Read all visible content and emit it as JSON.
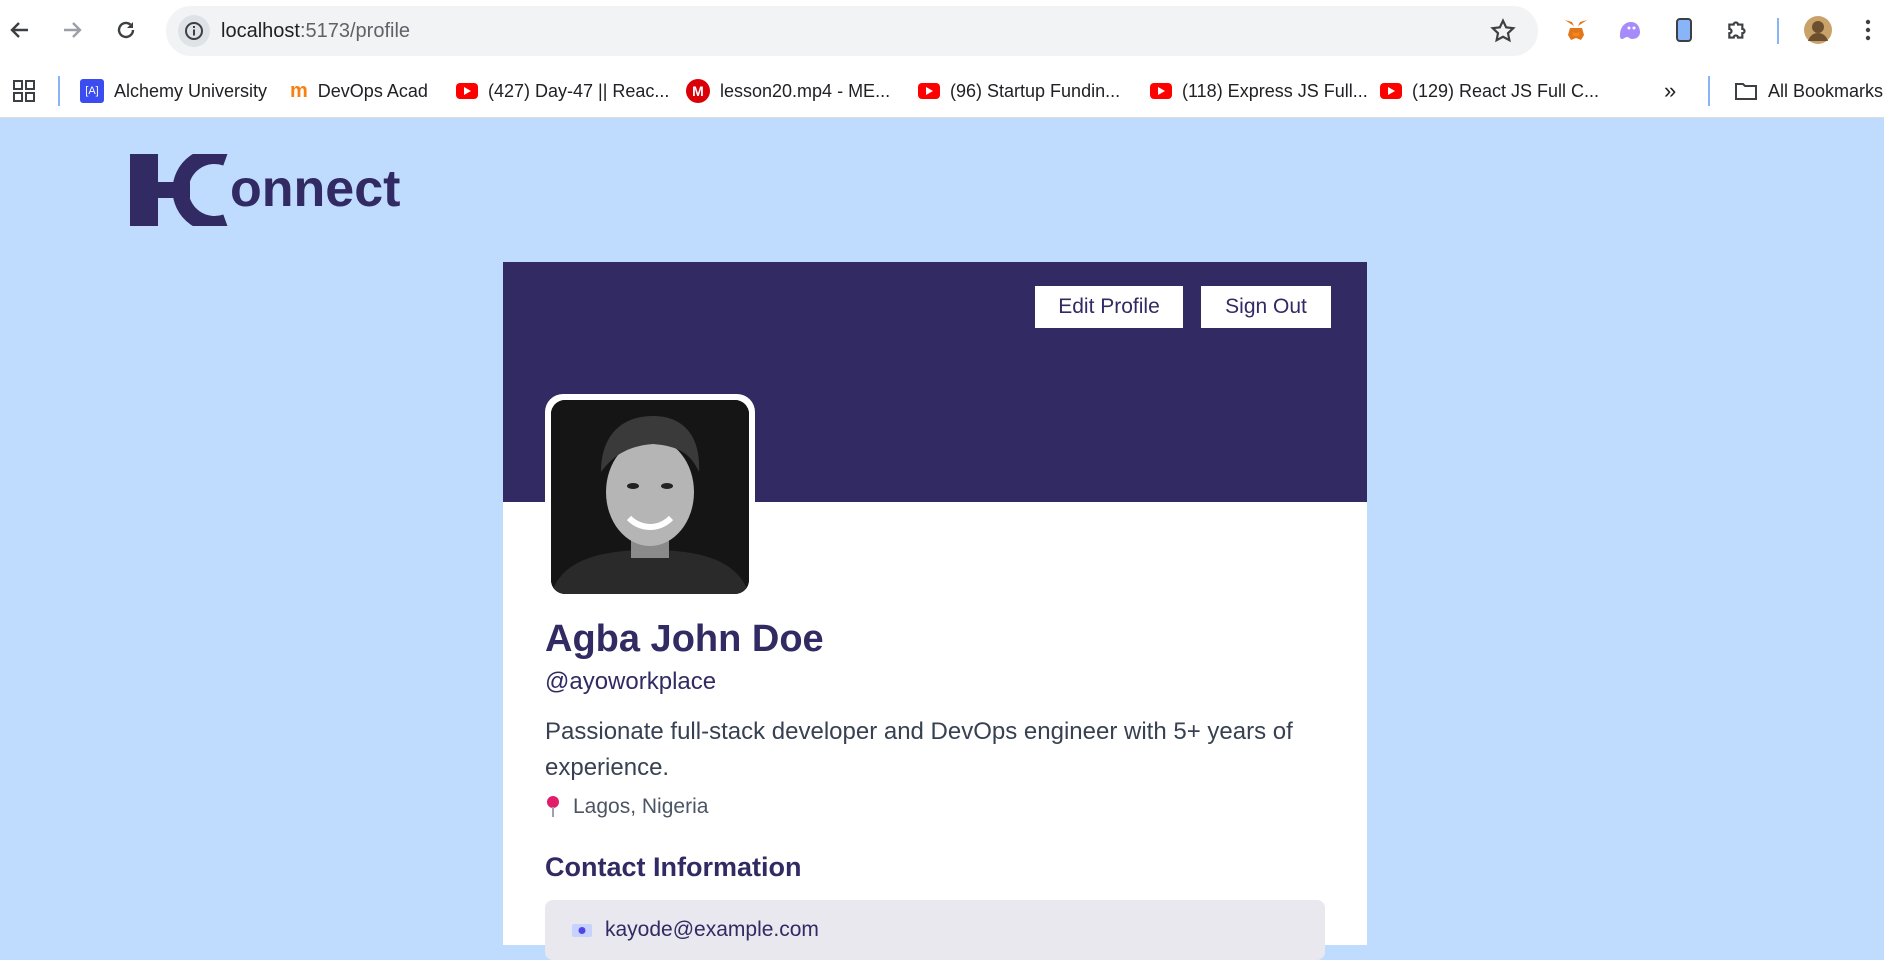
{
  "browser": {
    "url_host": "localhost",
    "url_path": ":5173/profile",
    "bookmarks": [
      {
        "label": "Alchemy University",
        "icon": "alchemy-icon"
      },
      {
        "label": "DevOps Acad",
        "icon": "moodle-icon"
      },
      {
        "label": "(427) Day-47 || Reac...",
        "icon": "youtube-icon"
      },
      {
        "label": "lesson20.mp4 - ME...",
        "icon": "mega-icon"
      },
      {
        "label": "(96) Startup Fundin...",
        "icon": "youtube-icon"
      },
      {
        "label": "(118) Express JS Full...",
        "icon": "youtube-icon"
      },
      {
        "label": "(129) React JS Full C...",
        "icon": "youtube-icon"
      }
    ],
    "more_bookmarks": "»",
    "all_bookmarks_label": "All Bookmarks"
  },
  "app": {
    "logo_text": "Konnect",
    "colors": {
      "primary": "#312a63",
      "background": "#bfdbfe"
    }
  },
  "profile": {
    "edit_label": "Edit Profile",
    "signout_label": "Sign Out",
    "name": "Agba John Doe",
    "handle": "@ayoworkplace",
    "bio": "Passionate full-stack developer and DevOps engineer with 5+ years of experience.",
    "location": "Lagos, Nigeria",
    "contact_title": "Contact Information",
    "email": "kayode@example.com"
  }
}
